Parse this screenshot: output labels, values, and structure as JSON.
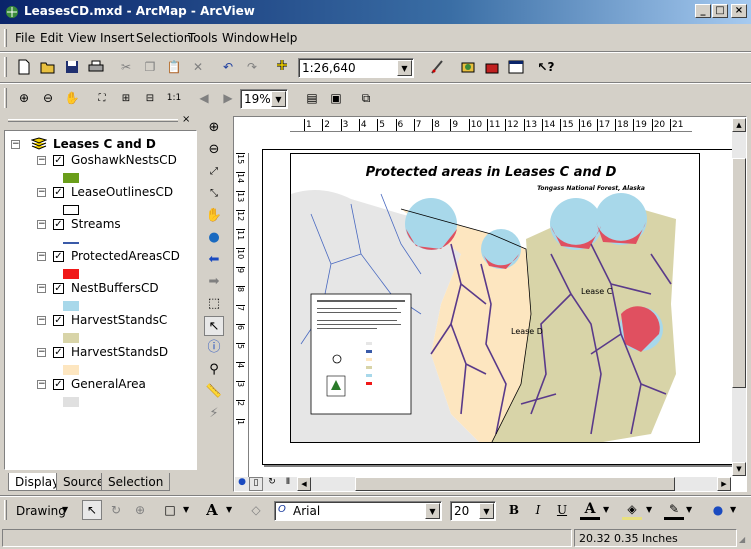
{
  "window": {
    "title": "LeasesCD.mxd - ArcMap - ArcView",
    "min": "_",
    "max": "□",
    "close": "×"
  },
  "menu": [
    "File",
    "Edit",
    "View",
    "Insert",
    "Selection",
    "Tools",
    "Window",
    "Help"
  ],
  "toolbar": {
    "scale": "1:26,640",
    "zoom": "19%"
  },
  "toc": {
    "frame": "Leases C and D",
    "layers": [
      {
        "name": "GoshawkNestsCD",
        "color": "#6a9e1a"
      },
      {
        "name": "LeaseOutlinesCD",
        "color": "#ffffff"
      },
      {
        "name": "Streams",
        "color": "#3a5aa8"
      },
      {
        "name": "ProtectedAreasCD",
        "color": "#f01818"
      },
      {
        "name": "NestBuffersCD",
        "color": "#a8d8ea"
      },
      {
        "name": "HarvestStandsC",
        "color": "#d8d4a8"
      },
      {
        "name": "HarvestStandsD",
        "color": "#fde6c0"
      },
      {
        "name": "GeneralArea",
        "color": "#e0e0e0"
      }
    ],
    "tabs": [
      "Display",
      "Source",
      "Selection"
    ]
  },
  "map": {
    "title": "Protected areas in Leases C and D",
    "subtitle": "Tongass National Forest, Alaska",
    "lease_c": "Lease C",
    "lease_d": "Lease D",
    "ruler": [
      "1",
      "2",
      "3",
      "4",
      "5",
      "6",
      "7",
      "8",
      "9",
      "10",
      "11",
      "12",
      "13",
      "14",
      "15",
      "16",
      "17",
      "18",
      "19",
      "20",
      "21"
    ]
  },
  "drawing": {
    "label": "Drawing",
    "font": "Arial",
    "size": "20",
    "bold": "B",
    "italic": "I",
    "underline": "U"
  },
  "status": {
    "coords": "20.32  0.35 Inches"
  }
}
